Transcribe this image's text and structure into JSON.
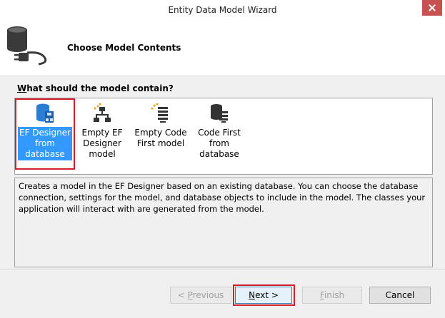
{
  "window": {
    "title": "Entity Data Model Wizard"
  },
  "header": {
    "title": "Choose Model Contents",
    "icon": "database-plug-icon"
  },
  "question": {
    "accel": "W",
    "rest": "hat should the model contain?"
  },
  "options": [
    {
      "line1": "EF Designer",
      "line2": "from",
      "line3": "database",
      "icon": "ef-designer-database-icon",
      "selected": true
    },
    {
      "line1": "Empty EF",
      "line2": "Designer",
      "line3": "model",
      "icon": "empty-ef-designer-icon",
      "selected": false
    },
    {
      "line1": "Empty Code",
      "line2": "First model",
      "line3": "",
      "icon": "empty-code-first-icon",
      "selected": false
    },
    {
      "line1": "Code First",
      "line2": "from",
      "line3": "database",
      "icon": "code-first-database-icon",
      "selected": false
    }
  ],
  "description": "Creates a model in the EF Designer based on an existing database. You can choose the database connection, settings for the model, and database objects to include in the model. The classes your application will interact with are generated from the model.",
  "buttons": {
    "previous": {
      "pre": "< ",
      "accel": "P",
      "rest": "revious",
      "enabled": false
    },
    "next": {
      "accel": "N",
      "rest": "ext >",
      "enabled": true
    },
    "finish": {
      "accel": "F",
      "rest": "inish",
      "enabled": false
    },
    "cancel": {
      "label": "Cancel",
      "enabled": true
    }
  },
  "colors": {
    "selection": "#3399ff",
    "highlight_border": "#d01f2f",
    "dialog_bg": "#f0f0f0"
  }
}
